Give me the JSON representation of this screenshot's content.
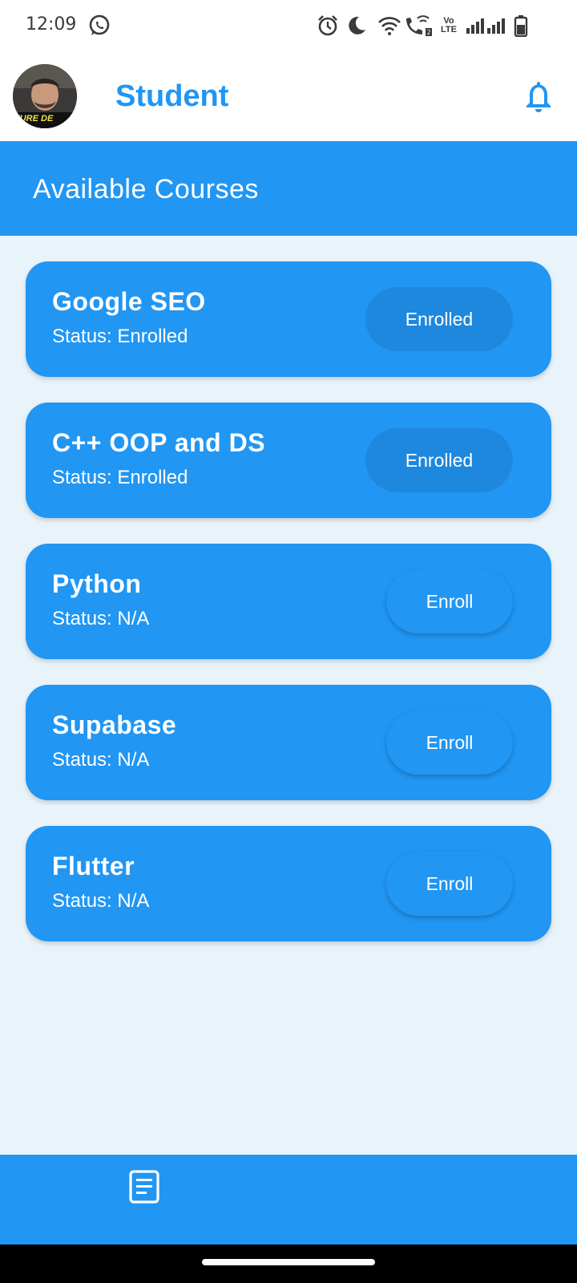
{
  "status_bar": {
    "time": "12:09",
    "network_label": "Vo LTE",
    "icons": [
      "whatsapp-icon",
      "alarm-icon",
      "do-not-disturb-moon-icon",
      "wifi-icon",
      "wifi-calling-icon",
      "volte-icon",
      "signal-icon",
      "signal-icon",
      "battery-icon"
    ]
  },
  "app_bar": {
    "title": "Student",
    "avatar_text": "TURE DE",
    "icons": [
      "avatar",
      "bell-icon"
    ]
  },
  "section": {
    "title": "Available Courses"
  },
  "courses": [
    {
      "name": "Google SEO",
      "status": "Status: Enrolled",
      "button": "Enrolled"
    },
    {
      "name": "C++ OOP and DS",
      "status": "Status: Enrolled",
      "button": "Enrolled"
    },
    {
      "name": "Python",
      "status": "Status: N/A",
      "button": "Enroll"
    },
    {
      "name": "Supabase",
      "status": "Status: N/A",
      "button": "Enroll"
    },
    {
      "name": "Flutter",
      "status": "Status: N/A",
      "button": "Enroll"
    }
  ],
  "bottom_nav": {
    "icons": [
      "article-icon"
    ]
  },
  "colors": {
    "primary": "#2196F3",
    "enrolled_button": "#1E88DE",
    "background": "#E8F3FA",
    "white": "#FFFFFF"
  }
}
